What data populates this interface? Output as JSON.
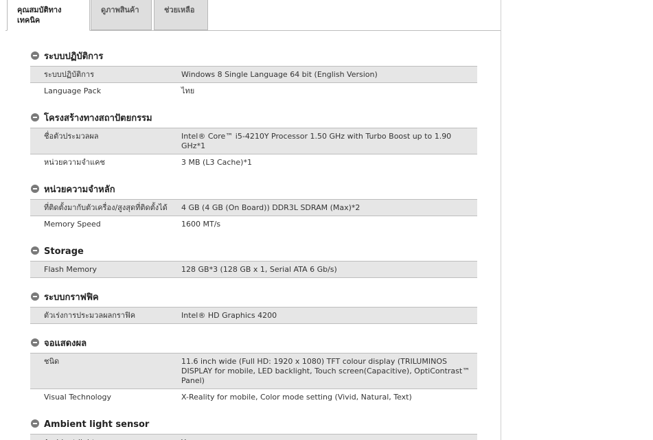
{
  "tabs": [
    {
      "label_line1": "คุณสมบัติทาง",
      "label_line2": "เทคนิค",
      "active": true
    },
    {
      "label": "ดูภาพสินค้า",
      "active": false
    },
    {
      "label": "ช่วยเหลือ",
      "active": false
    }
  ],
  "sections": [
    {
      "title": "ระบบปฏิบัติการ",
      "rows": [
        {
          "label": "ระบบปฏิบัติการ",
          "value": "Windows 8 Single Language 64 bit (English Version)"
        },
        {
          "label": "Language Pack",
          "value": "ไทย"
        }
      ]
    },
    {
      "title": "โครงสร้างทางสถาปัตยกรรม",
      "rows": [
        {
          "label": "ชื่อตัวประมวลผล",
          "value": "Intel® Core™ i5-4210Y Processor 1.50 GHz with Turbo Boost up to 1.90 GHz*1"
        },
        {
          "label": "หน่วยความจำแคช",
          "value": "3 MB (L3 Cache)*1"
        }
      ]
    },
    {
      "title": "หน่วยความจำหลัก",
      "rows": [
        {
          "label": "ที่ติดตั้งมากับตัวเครื่อง/สูงสุดที่ติดตั้งได้",
          "value": "4 GB (4 GB (On Board)) DDR3L SDRAM (Max)*2"
        },
        {
          "label": "Memory Speed",
          "value": "1600 MT/s"
        }
      ]
    },
    {
      "title": "Storage",
      "rows": [
        {
          "label": "Flash Memory",
          "value": "128 GB*3 (128 GB x 1, Serial ATA 6 Gb/s)"
        }
      ]
    },
    {
      "title": "ระบบกราฟฟิค",
      "rows": [
        {
          "label": "ตัวเร่งการประมวลผลกราฟิค",
          "value": "Intel® HD Graphics 4200"
        }
      ]
    },
    {
      "title": "จอแสดงผล",
      "rows": [
        {
          "label": "ชนิด",
          "value": "11.6 inch wide (Full HD: 1920 x 1080) TFT colour display (TRILUMINOS DISPLAY for mobile, LED backlight, Touch screen(Capacitive), OptiContrast™ Panel)"
        },
        {
          "label": "Visual Technology",
          "value": "X-Reality for mobile, Color mode setting (Vivid, Natural, Text)"
        }
      ]
    },
    {
      "title": "Ambient light sensor",
      "rows": [
        {
          "label": "Ambient light sensor",
          "value": "Yes"
        }
      ]
    }
  ]
}
